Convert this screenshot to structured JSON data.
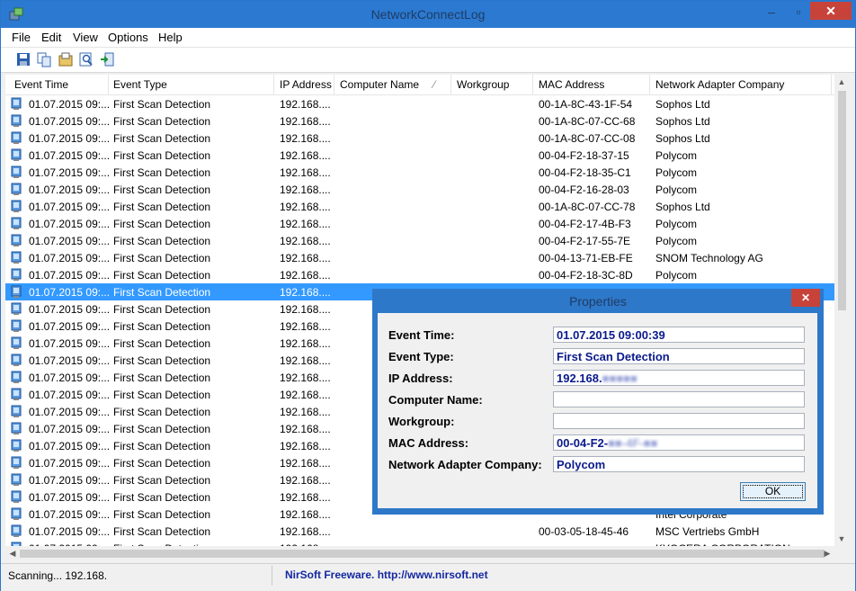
{
  "window": {
    "title": "NetworkConnectLog",
    "minimize": "–",
    "maximize": "▫",
    "close": "✕"
  },
  "menu": [
    "File",
    "Edit",
    "View",
    "Options",
    "Help"
  ],
  "toolbar": [
    "save-icon",
    "copy-icon",
    "properties-icon",
    "find-icon",
    "exit-icon"
  ],
  "columns": [
    "Event Time",
    "Event Type",
    "IP Address",
    "Computer Name",
    "Workgroup",
    "MAC Address",
    "Network Adapter Company"
  ],
  "sort_indicator": "⁄",
  "rows": [
    {
      "time": "01.07.2015 09:...",
      "type": "First Scan Detection",
      "ip": "192.168....",
      "mac": "00-1A-8C-43-1F-54",
      "company": "Sophos Ltd"
    },
    {
      "time": "01.07.2015 09:...",
      "type": "First Scan Detection",
      "ip": "192.168....",
      "mac": "00-1A-8C-07-CC-68",
      "company": "Sophos Ltd"
    },
    {
      "time": "01.07.2015 09:...",
      "type": "First Scan Detection",
      "ip": "192.168....",
      "mac": "00-1A-8C-07-CC-08",
      "company": "Sophos Ltd"
    },
    {
      "time": "01.07.2015 09:...",
      "type": "First Scan Detection",
      "ip": "192.168....",
      "mac": "00-04-F2-18-37-15",
      "company": "Polycom"
    },
    {
      "time": "01.07.2015 09:...",
      "type": "First Scan Detection",
      "ip": "192.168....",
      "mac": "00-04-F2-18-35-C1",
      "company": "Polycom"
    },
    {
      "time": "01.07.2015 09:...",
      "type": "First Scan Detection",
      "ip": "192.168....",
      "mac": "00-04-F2-16-28-03",
      "company": "Polycom"
    },
    {
      "time": "01.07.2015 09:...",
      "type": "First Scan Detection",
      "ip": "192.168....",
      "mac": "00-1A-8C-07-CC-78",
      "company": "Sophos Ltd"
    },
    {
      "time": "01.07.2015 09:...",
      "type": "First Scan Detection",
      "ip": "192.168....",
      "mac": "00-04-F2-17-4B-F3",
      "company": "Polycom"
    },
    {
      "time": "01.07.2015 09:...",
      "type": "First Scan Detection",
      "ip": "192.168....",
      "mac": "00-04-F2-17-55-7E",
      "company": "Polycom"
    },
    {
      "time": "01.07.2015 09:...",
      "type": "First Scan Detection",
      "ip": "192.168....",
      "mac": "00-04-13-71-EB-FE",
      "company": "SNOM Technology AG"
    },
    {
      "time": "01.07.2015 09:...",
      "type": "First Scan Detection",
      "ip": "192.168....",
      "mac": "00-04-F2-18-3C-8D",
      "company": "Polycom"
    },
    {
      "time": "01.07.2015 09:...",
      "type": "First Scan Detection",
      "ip": "192.168....",
      "mac": "",
      "company": "",
      "selected": true
    },
    {
      "time": "01.07.2015 09:...",
      "type": "First Scan Detection",
      "ip": "192.168....",
      "mac": "",
      "company": ""
    },
    {
      "time": "01.07.2015 09:...",
      "type": "First Scan Detection",
      "ip": "192.168....",
      "mac": "",
      "company": ""
    },
    {
      "time": "01.07.2015 09:...",
      "type": "First Scan Detection",
      "ip": "192.168....",
      "mac": "",
      "company": ""
    },
    {
      "time": "01.07.2015 09:...",
      "type": "First Scan Detection",
      "ip": "192.168....",
      "mac": "",
      "company": ""
    },
    {
      "time": "01.07.2015 09:...",
      "type": "First Scan Detection",
      "ip": "192.168....",
      "mac": "",
      "company": ""
    },
    {
      "time": "01.07.2015 09:...",
      "type": "First Scan Detection",
      "ip": "192.168....",
      "mac": "",
      "company": ""
    },
    {
      "time": "01.07.2015 09:...",
      "type": "First Scan Detection",
      "ip": "192.168....",
      "mac": "",
      "company": ""
    },
    {
      "time": "01.07.2015 09:...",
      "type": "First Scan Detection",
      "ip": "192.168....",
      "mac": "",
      "company": ""
    },
    {
      "time": "01.07.2015 09:...",
      "type": "First Scan Detection",
      "ip": "192.168....",
      "mac": "",
      "company": ""
    },
    {
      "time": "01.07.2015 09:...",
      "type": "First Scan Detection",
      "ip": "192.168....",
      "mac": "",
      "company": ""
    },
    {
      "time": "01.07.2015 09:...",
      "type": "First Scan Detection",
      "ip": "192.168....",
      "mac": "",
      "company": ""
    },
    {
      "time": "01.07.2015 09:...",
      "type": "First Scan Detection",
      "ip": "192.168....",
      "mac": "",
      "company": ""
    },
    {
      "time": "01.07.2015 09:...",
      "type": "First Scan Detection",
      "ip": "192.168....",
      "mac": "",
      "company": "Intel Corporate"
    },
    {
      "time": "01.07.2015 09:...",
      "type": "First Scan Detection",
      "ip": "192.168....",
      "mac": "00-03-05-18-45-46",
      "company": "MSC Vertriebs GmbH"
    },
    {
      "time": "01.07.2015 09:...",
      "type": "First Scan Detection",
      "ip": "192.168....",
      "mac": "",
      "company": "KYOCERA CORPORATION"
    }
  ],
  "status": {
    "left": "Scanning...   192.168.",
    "right": "NirSoft Freeware.  http://www.nirsoft.net"
  },
  "dialog": {
    "title": "Properties",
    "close": "✕",
    "fields": [
      {
        "label": "Event Time:",
        "value": "01.07.2015 09:00:39"
      },
      {
        "label": "Event Type:",
        "value": "First Scan Detection"
      },
      {
        "label": "IP Address:",
        "value": "192.168."
      },
      {
        "label": "Computer Name:",
        "value": ""
      },
      {
        "label": "Workgroup:",
        "value": ""
      },
      {
        "label": "MAC Address:",
        "value": "00-04-F2-"
      },
      {
        "label": "Network Adapter Company:",
        "value": "Polycom"
      }
    ],
    "ok": "OK"
  }
}
